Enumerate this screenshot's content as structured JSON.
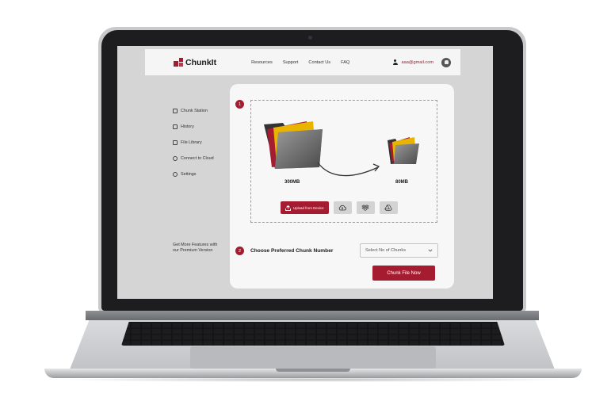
{
  "brand": {
    "name": "ChunkIt",
    "accent": "#a51c30"
  },
  "nav": {
    "links": [
      "Resources",
      "Support",
      "Contact Us",
      "FAQ"
    ],
    "user_email": "aaa@gmail.com",
    "user_icon": "user-icon",
    "notification_icon": "bell-icon"
  },
  "sidebar": {
    "items": [
      {
        "label": "Chunk Station",
        "icon": "station-icon",
        "active": true
      },
      {
        "label": "History",
        "icon": "history-icon"
      },
      {
        "label": "File Library",
        "icon": "file-icon"
      },
      {
        "label": "Connect to Cloud",
        "icon": "cloud-icon"
      },
      {
        "label": "Settings",
        "icon": "settings-icon"
      }
    ],
    "premium_text": "Get More Features with our Premium Version"
  },
  "upload": {
    "step": "1",
    "original_size": "300MB",
    "chunk_size": "80MB",
    "upload_button": "Upload from Device",
    "cloud_buttons": [
      "cloud-upload-icon",
      "dropbox-icon",
      "google-drive-icon"
    ]
  },
  "chunks": {
    "step": "2",
    "label": "Choose Preferred Chunk Number",
    "select_placeholder": "Select No of Chunks",
    "submit_button": "Chunk File Now"
  }
}
